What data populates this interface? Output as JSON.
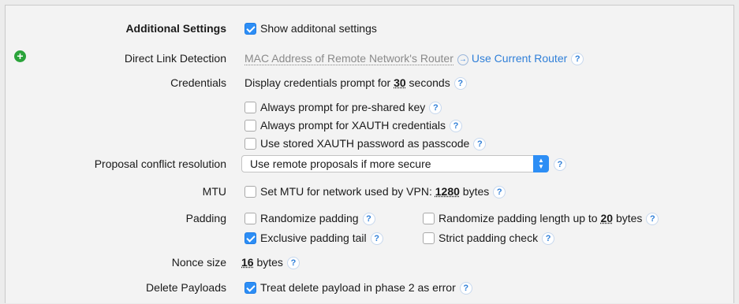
{
  "additional": {
    "label": "Additional Settings",
    "checkbox_label": "Show additonal settings",
    "checked": true
  },
  "direct_link": {
    "label": "Direct Link Detection",
    "placeholder": "MAC Address of Remote Network's Router",
    "action": "Use Current Router",
    "add_icon": "plus-circle-icon",
    "arrow_icon": "arrow-right-circle-icon"
  },
  "credentials": {
    "label": "Credentials",
    "prompt_prefix": "Display credentials prompt for",
    "seconds_value": "30",
    "prompt_suffix": "seconds",
    "options": [
      {
        "label": "Always prompt for pre-shared key",
        "checked": false
      },
      {
        "label": "Always prompt for XAUTH credentials",
        "checked": false
      },
      {
        "label": "Use stored XAUTH password as passcode",
        "checked": false
      }
    ]
  },
  "proposal": {
    "label": "Proposal conflict resolution",
    "selected": "Use remote proposals if more secure"
  },
  "mtu": {
    "label": "MTU",
    "prefix": "Set MTU for network used by VPN:",
    "value": "1280",
    "suffix": "bytes",
    "checked": false
  },
  "padding": {
    "label": "Padding",
    "randomize": "Randomize padding",
    "randomize_length_prefix": "Randomize padding length up to",
    "randomize_length_value": "20",
    "randomize_length_suffix": "bytes",
    "exclusive_tail": "Exclusive padding tail",
    "exclusive_checked": true,
    "strict_check": "Strict padding check"
  },
  "nonce": {
    "label": "Nonce size",
    "value": "16",
    "suffix": "bytes"
  },
  "delete_payloads": {
    "label": "Delete Payloads",
    "checkbox_label": "Treat delete payload in phase 2 as error",
    "checked": true
  },
  "help_glyph": "?",
  "accent_color": "#2d8ef5"
}
